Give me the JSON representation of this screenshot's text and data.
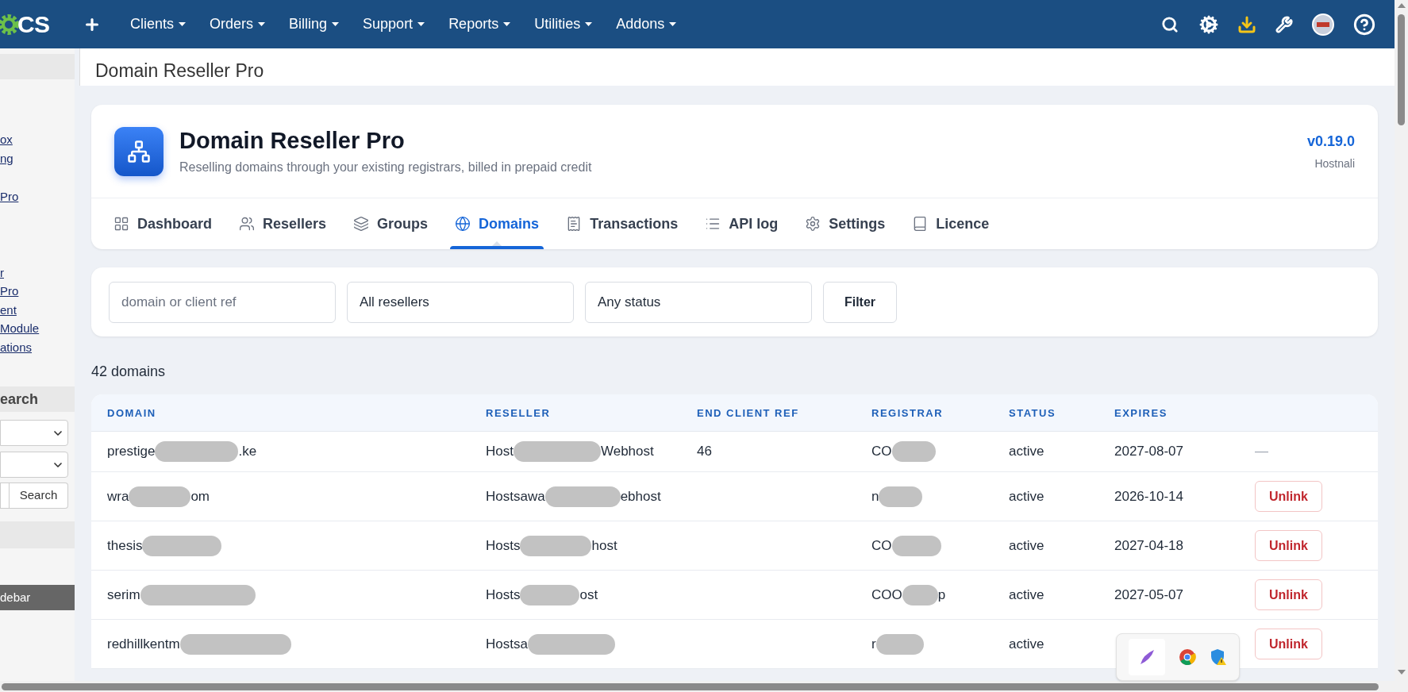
{
  "nav": {
    "logo_text": "CS",
    "items": [
      {
        "label": "Clients"
      },
      {
        "label": "Orders"
      },
      {
        "label": "Billing"
      },
      {
        "label": "Support"
      },
      {
        "label": "Reports"
      },
      {
        "label": "Utilities"
      },
      {
        "label": "Addons"
      }
    ]
  },
  "sidebar": {
    "link_groups": [
      [
        "ox",
        "ng"
      ],
      [
        "Pro"
      ],
      [
        "r",
        "Pro",
        "ent",
        "Module",
        "ations"
      ]
    ],
    "search_heading": "earch",
    "search_button": "Search",
    "hide_button": "debar"
  },
  "page_title": "Domain Reseller Pro",
  "module": {
    "title": "Domain Reseller Pro",
    "subtitle": "Reselling domains through your existing registrars, billed in prepaid credit",
    "version": "v0.19.0",
    "vendor": "Hostnali"
  },
  "tabs": [
    {
      "kind": "dashboard",
      "label": "Dashboard",
      "selected": false
    },
    {
      "kind": "resellers",
      "label": "Resellers",
      "selected": false
    },
    {
      "kind": "groups",
      "label": "Groups",
      "selected": false
    },
    {
      "kind": "domains",
      "label": "Domains",
      "selected": true
    },
    {
      "kind": "transactions",
      "label": "Transactions",
      "selected": false
    },
    {
      "kind": "apilog",
      "label": "API log",
      "selected": false
    },
    {
      "kind": "settings",
      "label": "Settings",
      "selected": false
    },
    {
      "kind": "licence",
      "label": "Licence",
      "selected": false
    }
  ],
  "filter": {
    "search_placeholder": "domain or client ref",
    "reseller_select": "All resellers",
    "status_select": "Any status",
    "button": "Filter"
  },
  "count": "42 domains",
  "table": {
    "columns": [
      "DOMAIN",
      "RESELLER",
      "END CLIENT REF",
      "REGISTRAR",
      "STATUS",
      "EXPIRES"
    ],
    "rows": [
      {
        "domain": {
          "before": "prestige",
          "after": ".ke",
          "redacted": true
        },
        "reseller": {
          "before": "Host",
          "after": "Webhost",
          "redacted": true
        },
        "client_ref": "46",
        "registrar": {
          "before": "CO",
          "redacted": true
        },
        "status": "active",
        "expires": "2027-08-07",
        "action": {
          "kind": "none",
          "label": "—"
        }
      },
      {
        "domain": {
          "before": "wra",
          "after": "om",
          "redacted": true
        },
        "reseller": {
          "before": "Hostsawa",
          "after": "ebhost",
          "redacted": true
        },
        "registrar": {
          "before": "n",
          "redacted": true
        },
        "status": "active",
        "expires": "2026-10-14",
        "action": {
          "kind": "button",
          "label": "Unlink"
        }
      },
      {
        "domain": {
          "before": "thesis",
          "redacted": true
        },
        "reseller": {
          "before": "Hosts",
          "after": "host",
          "redacted": true
        },
        "registrar": {
          "before": "CO",
          "redacted": true
        },
        "status": "active",
        "expires": "2027-04-18",
        "action": {
          "kind": "button",
          "label": "Unlink"
        }
      },
      {
        "domain": {
          "before": "serim",
          "redacted": true
        },
        "reseller": {
          "before": "Hosts",
          "after": "ost",
          "redacted": true
        },
        "registrar": {
          "before": "COO",
          "after": "p",
          "redacted": true
        },
        "status": "active",
        "expires": "2027-05-07",
        "action": {
          "kind": "button",
          "label": "Unlink"
        }
      },
      {
        "domain": {
          "before": "redhillkentm",
          "redacted": true
        },
        "reseller": {
          "before": "Hostsa",
          "redacted": true
        },
        "registrar": {
          "before": "r",
          "redacted": true
        },
        "status": "active",
        "action": {
          "kind": "button",
          "label": "Unlink"
        }
      }
    ]
  }
}
